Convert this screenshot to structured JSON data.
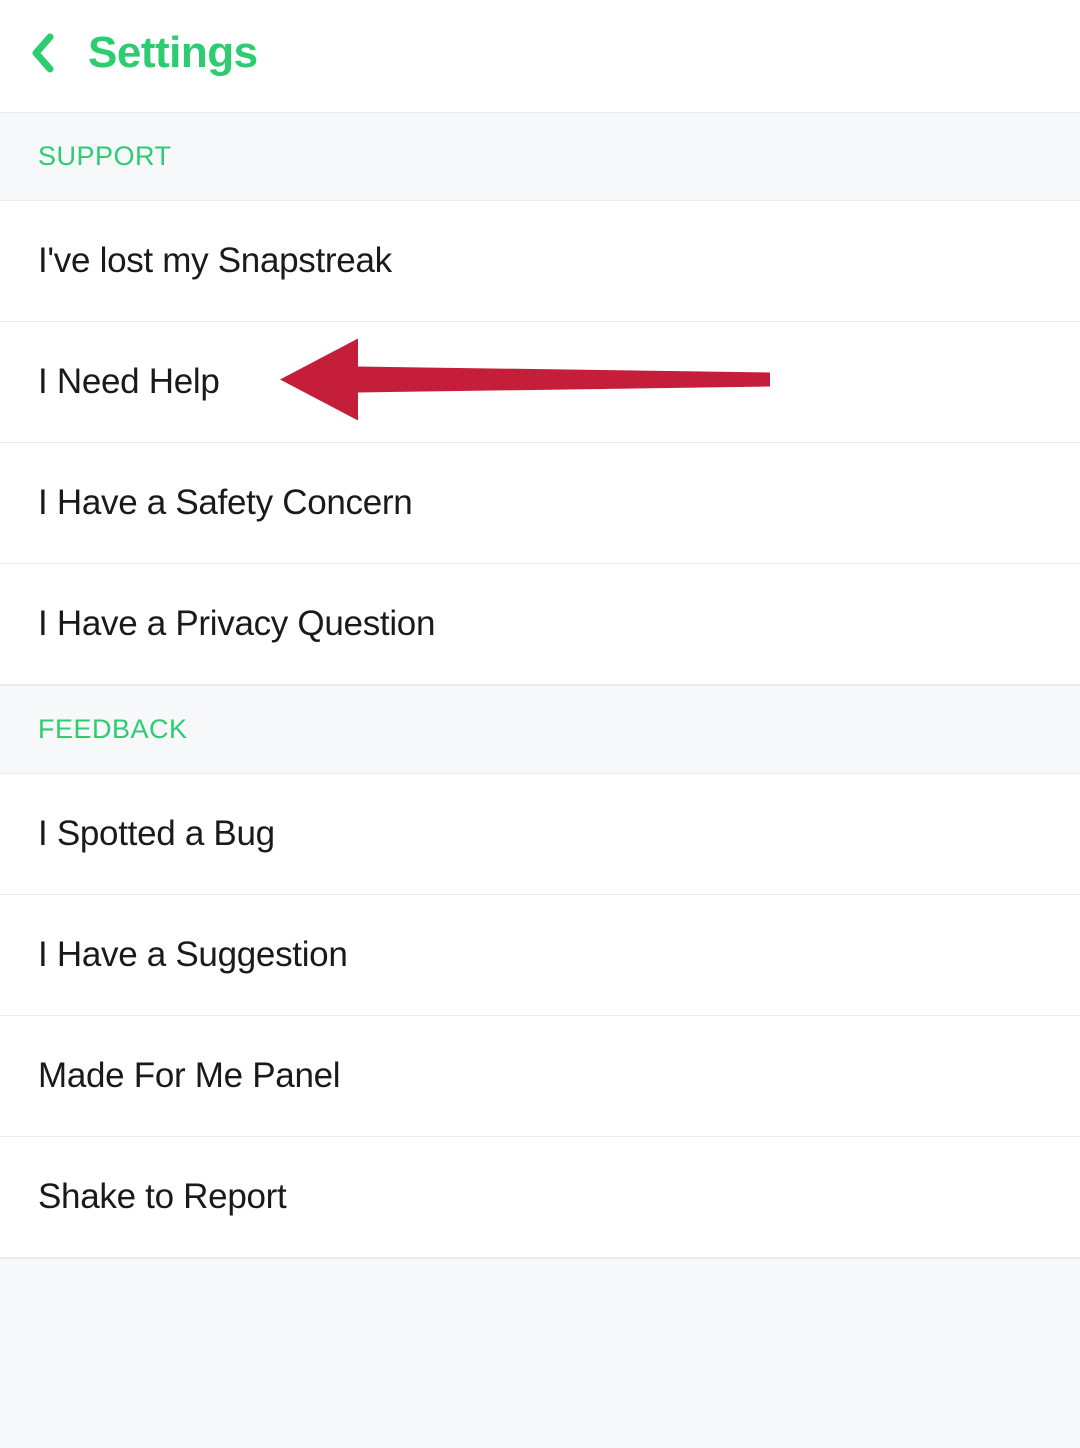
{
  "header": {
    "title": "Settings"
  },
  "sections": [
    {
      "header": "SUPPORT",
      "items": [
        {
          "label": "I've lost my Snapstreak"
        },
        {
          "label": "I Need Help",
          "highlighted": true
        },
        {
          "label": "I Have a Safety Concern"
        },
        {
          "label": "I Have a Privacy Question"
        }
      ]
    },
    {
      "header": "FEEDBACK",
      "items": [
        {
          "label": "I Spotted a Bug"
        },
        {
          "label": "I Have a Suggestion"
        },
        {
          "label": "Made For Me Panel"
        },
        {
          "label": "Shake to Report"
        }
      ]
    }
  ],
  "colors": {
    "accent": "#2ecc71",
    "annotation": "#c41e3a"
  }
}
